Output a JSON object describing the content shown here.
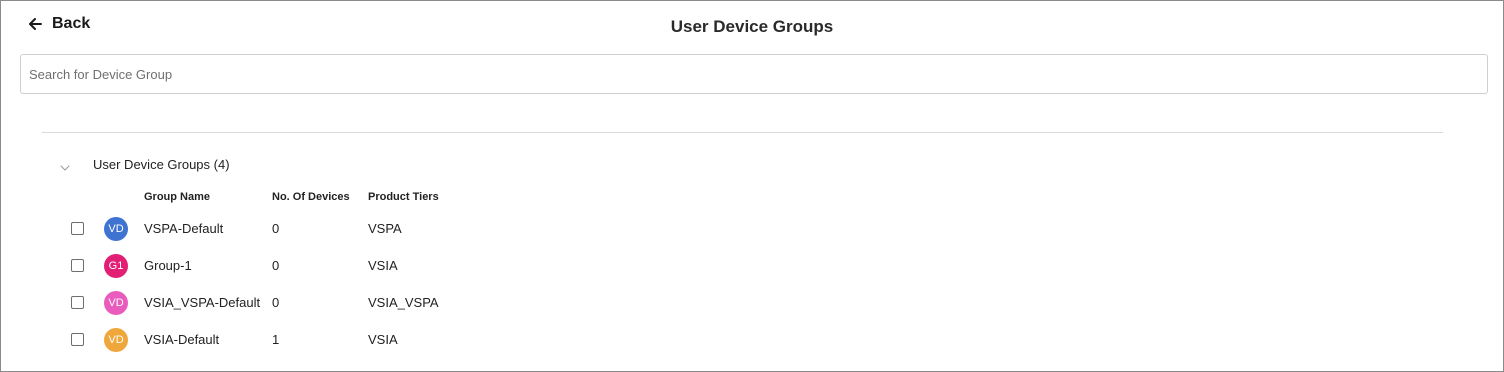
{
  "header": {
    "back_label": "Back",
    "title": "User Device Groups"
  },
  "search": {
    "placeholder": "Search for Device Group",
    "value": ""
  },
  "group": {
    "label": "User Device Groups (4)",
    "expanded": true
  },
  "table": {
    "columns": [
      "Group Name",
      "No. Of Devices",
      "Product Tiers"
    ],
    "rows": [
      {
        "initials": "VD",
        "avatar_color": "#3f73d1",
        "name": "VSPA-Default",
        "devices": "0",
        "tier": "VSPA"
      },
      {
        "initials": "G1",
        "avatar_color": "#e21e75",
        "name": "Group-1",
        "devices": "0",
        "tier": "VSIA"
      },
      {
        "initials": "VD",
        "avatar_color": "#e95bbd",
        "name": "VSIA_VSPA-Default",
        "devices": "0",
        "tier": "VSIA_VSPA"
      },
      {
        "initials": "VD",
        "avatar_color": "#efa63a",
        "name": "VSIA-Default",
        "devices": "1",
        "tier": "VSIA"
      }
    ]
  },
  "icons": {
    "back": "arrow-left-icon",
    "expand": "chevron-down-icon"
  }
}
